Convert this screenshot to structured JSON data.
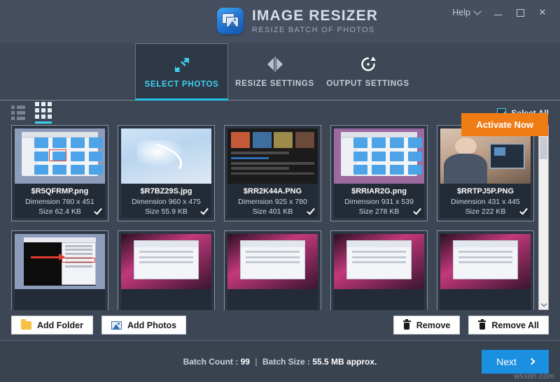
{
  "titlebar": {
    "app_title": "IMAGE RESIZER",
    "app_subtitle": "RESIZE BATCH OF PHOTOS",
    "logo_icon": "image-stack-icon",
    "help_label": "Help",
    "help_chevron_icon": "chevron-down-icon",
    "minimize_icon": "minimize-icon",
    "maximize_icon": "maximize-icon",
    "close_icon": "close-icon",
    "close_glyph": "✕"
  },
  "tabs": [
    {
      "label": "SELECT PHOTOS",
      "icon": "resize-arrows-icon",
      "active": true
    },
    {
      "label": "RESIZE SETTINGS",
      "icon": "flip-horizontal-icon",
      "active": false
    },
    {
      "label": "OUTPUT SETTINGS",
      "icon": "refresh-circle-icon",
      "active": false
    }
  ],
  "activate": {
    "label": "Activate Now",
    "color": "#f07c16"
  },
  "viewbar": {
    "list_view_icon": "list-view-icon",
    "grid_view_icon": "grid-view-icon",
    "active_view": "grid",
    "select_all_label": "Select All",
    "select_all_checked": true
  },
  "photos": [
    {
      "name": "$R5QFRMP.png",
      "dimension": "Dimension 780 x 451",
      "size": "Size 62.4 KB",
      "checked": true,
      "art": "finder"
    },
    {
      "name": "$R7BZ29S.jpg",
      "dimension": "Dimension 960 x 475",
      "size": "Size 55.9 KB",
      "checked": true,
      "art": "sky"
    },
    {
      "name": "$RR2K44A.PNG",
      "dimension": "Dimension 925 x 780",
      "size": "Size 401 KB",
      "checked": true,
      "art": "news"
    },
    {
      "name": "$RRIAR2G.png",
      "dimension": "Dimension 931 x 539",
      "size": "Size 278 KB",
      "checked": true,
      "art": "dialog"
    },
    {
      "name": "$RRTPJ5P.PNG",
      "dimension": "Dimension 431 x 445",
      "size": "Size 222 KB",
      "checked": true,
      "art": "person"
    }
  ],
  "photos_row2": [
    {
      "art": "menu"
    },
    {
      "art": "pinkdlg"
    },
    {
      "art": "pinkdlg"
    },
    {
      "art": "pinkdlg"
    },
    {
      "art": "pinkdlg"
    }
  ],
  "scrollbar": {
    "up_icon": "scroll-up-arrow-icon",
    "down_icon": "scroll-down-arrow-icon"
  },
  "actions": {
    "add_folder_label": "Add Folder",
    "add_folder_icon": "folder-icon",
    "add_photos_label": "Add Photos",
    "add_photos_icon": "photo-icon",
    "remove_label": "Remove",
    "remove_icon": "trash-icon",
    "remove_all_label": "Remove All",
    "remove_all_icon": "trash-icon"
  },
  "status": {
    "batch_count_label": "Batch Count :",
    "batch_count_value": "99",
    "separator": "|",
    "batch_size_label": "Batch Size :",
    "batch_size_value": "55.5 MB approx.",
    "next_label": "Next",
    "next_icon": "chevron-right-icon",
    "next_color": "#1b8fe0",
    "watermark": "wsxdn.com"
  }
}
